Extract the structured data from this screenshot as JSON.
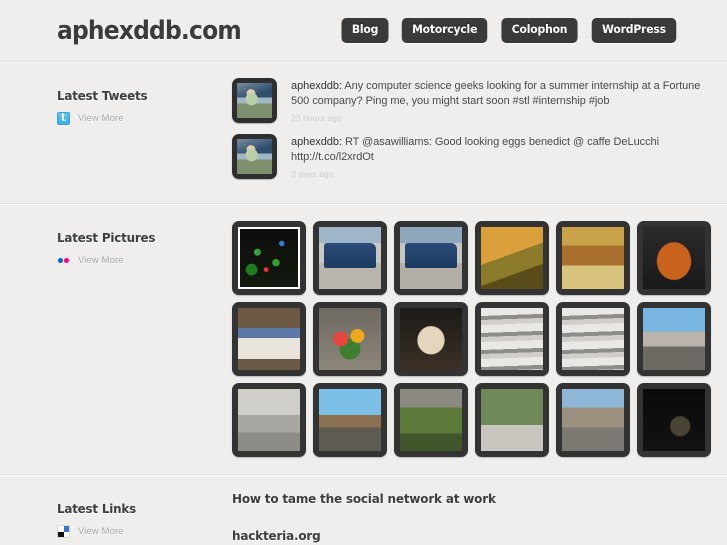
{
  "header": {
    "logo": "aphexddb.com",
    "nav": [
      {
        "label": "Blog",
        "name": "nav-blog"
      },
      {
        "label": "Motorcycle",
        "name": "nav-motorcycle"
      },
      {
        "label": "Colophon",
        "name": "nav-colophon"
      },
      {
        "label": "WordPress",
        "name": "nav-wordpress"
      }
    ]
  },
  "tweets_section": {
    "title": "Latest Tweets",
    "view_more": "View More",
    "icon": "twitter-icon",
    "items": [
      {
        "user": "aphexddb:",
        "text": " Any computer science geeks looking for a summer internship at a Fortune 500 company? Ping me, you might start soon #stl #internship #job",
        "time": "23 hours ago"
      },
      {
        "user": "aphexddb:",
        "text": " RT @asawilliams: Good looking eggs benedict @ caffe DeLucchi http://t.co/l2xrdOt",
        "time": "3 days ago"
      }
    ]
  },
  "pictures_section": {
    "title": "Latest Pictures",
    "view_more": "View More",
    "icon": "flickr-icon",
    "thumbnails": [
      {
        "alt": "green-bushes-night"
      },
      {
        "alt": "blue-suv-parked"
      },
      {
        "alt": "blue-suv-parked-2"
      },
      {
        "alt": "sliced-cake"
      },
      {
        "alt": "pie-slice-server"
      },
      {
        "alt": "roast-turkey-pan"
      },
      {
        "alt": "steamed-buns-tray"
      },
      {
        "alt": "flower-bouquet"
      },
      {
        "alt": "turkey-in-oven"
      },
      {
        "alt": "atrium-balconies"
      },
      {
        "alt": "atrium-balconies-2"
      },
      {
        "alt": "crowd-city-walkway"
      },
      {
        "alt": "concrete-plaza"
      },
      {
        "alt": "railway-city-view"
      },
      {
        "alt": "overgrown-rooftop"
      },
      {
        "alt": "garden-path-trees"
      },
      {
        "alt": "urban-walkway-buildings"
      },
      {
        "alt": "night-city-dark"
      }
    ]
  },
  "links_section": {
    "title": "Latest Links",
    "view_more": "View More",
    "icon": "delicious-icon",
    "items": [
      {
        "label": "How to tame the social network at work"
      },
      {
        "label": "hackteria.org"
      }
    ]
  },
  "colors": {
    "page_bg": "#efeeec",
    "button_bg": "#3a3a3a",
    "thumb_frame": "#333333",
    "twitter_blue": "#3aafe4",
    "flickr_blue": "#0063dc",
    "flickr_pink": "#ff0084",
    "delicious_blue": "#3274d6"
  }
}
